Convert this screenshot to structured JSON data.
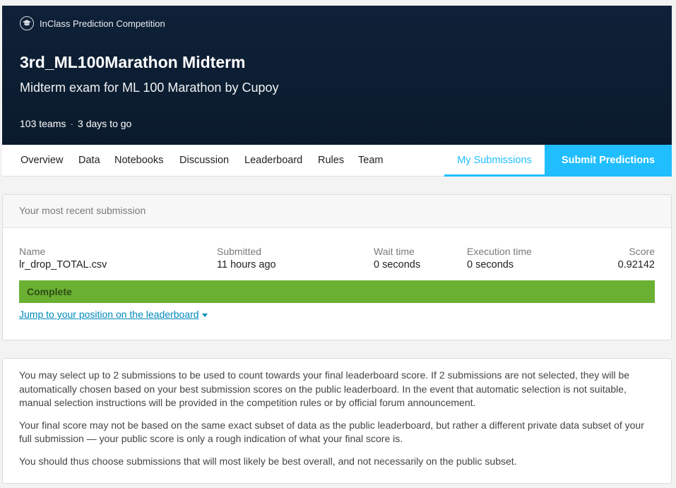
{
  "header": {
    "badge": "InClass Prediction Competition",
    "badge_icon": "graduation-cap-icon",
    "title": "3rd_ML100Marathon Midterm",
    "subtitle": "Midterm exam for ML 100 Marathon by Cupoy",
    "teams": "103 teams",
    "separator": "·",
    "deadline": "3 days to go"
  },
  "nav": {
    "tabs": [
      "Overview",
      "Data",
      "Notebooks",
      "Discussion",
      "Leaderboard",
      "Rules",
      "Team"
    ],
    "my_submissions": "My Submissions",
    "submit_predictions": "Submit Predictions"
  },
  "recent_submission": {
    "heading": "Your most recent submission",
    "name_label": "Name",
    "name_value": "lr_drop_TOTAL.csv",
    "submitted_label": "Submitted",
    "submitted_value": "11 hours ago",
    "wait_label": "Wait time",
    "wait_value": "0 seconds",
    "exec_label": "Execution time",
    "exec_value": "0 seconds",
    "score_label": "Score",
    "score_value": "0.92142",
    "status": "Complete",
    "jump_link": "Jump to your position on the leaderboard"
  },
  "info": {
    "p1": "You may select up to 2 submissions to be used to count towards your final leaderboard score. If 2 submissions are not selected, they will be automatically chosen based on your best submission scores on the public leaderboard. In the event that automatic selection is not suitable, manual selection instructions will be provided in the competition rules or by official forum announcement.",
    "p2": "Your final score may not be based on the same exact subset of data as the public leaderboard, but rather a different private data subset of your full submission — your public score is only a rough indication of what your final score is.",
    "p3": "You should thus choose submissions that will most likely be best overall, and not necessarily on the public subset."
  },
  "colors": {
    "banner": "#0e2138",
    "accent": "#20beff",
    "status_green": "#6ab033",
    "link": "#008abc"
  }
}
